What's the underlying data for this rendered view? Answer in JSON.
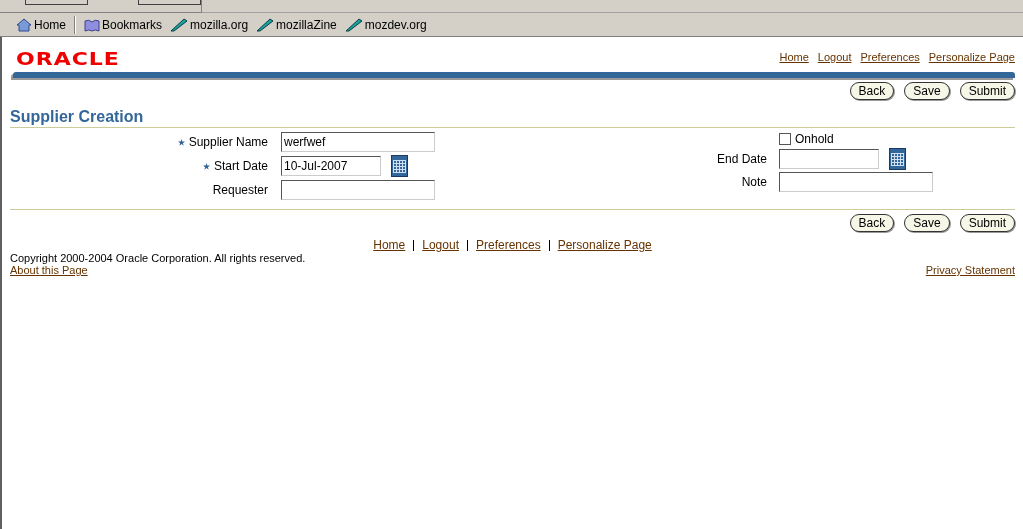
{
  "browser": {
    "bookmarks": [
      {
        "label": "Home",
        "kind": "home"
      },
      {
        "label": "Bookmarks",
        "kind": "bookmarks"
      },
      {
        "label": "mozilla.org",
        "kind": "link"
      },
      {
        "label": "mozillaZine",
        "kind": "link"
      },
      {
        "label": "mozdev.org",
        "kind": "link"
      }
    ]
  },
  "header": {
    "logo": "ORACLE",
    "global_links": [
      "Home",
      "Logout",
      "Preferences",
      "Personalize Page"
    ]
  },
  "top_buttons": [
    "Back",
    "Save",
    "Submit"
  ],
  "page_title": "Supplier Creation",
  "left_fields": [
    {
      "kind": "text",
      "label": "Supplier Name",
      "required": true,
      "value": "werfwef"
    },
    {
      "kind": "date",
      "label": "Start Date",
      "required": true,
      "value": "10-Jul-2007"
    },
    {
      "kind": "text",
      "label": "Requester",
      "required": false
    }
  ],
  "right_fields": [
    {
      "kind": "checkbox",
      "label": "Onhold",
      "checked": false
    },
    {
      "kind": "date",
      "label": "End Date"
    },
    {
      "kind": "text",
      "label": "Note"
    }
  ],
  "bottom_buttons": [
    "Back",
    "Save",
    "Submit"
  ],
  "footer": {
    "links": [
      "Home",
      "Logout",
      "Preferences",
      "Personalize Page"
    ],
    "copyright": "Copyright 2000-2004 Oracle Corporation. All rights reserved.",
    "about_link": "About this Page",
    "privacy_link": "Privacy Statement"
  }
}
